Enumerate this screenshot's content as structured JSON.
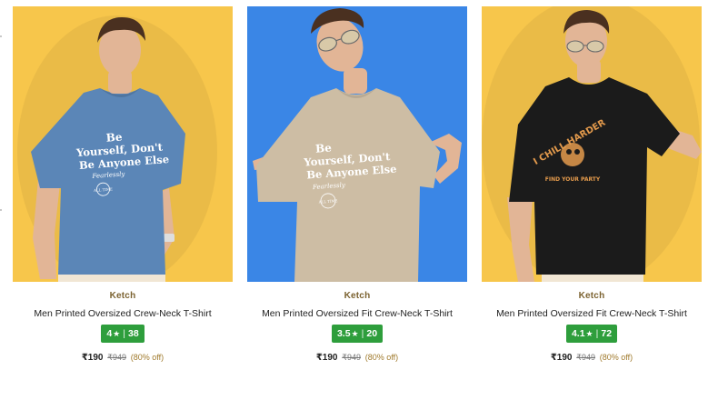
{
  "products": [
    {
      "brand": "Ketch",
      "title": "Men Printed Oversized Crew-Neck T-Shirt",
      "rating": "4",
      "star": "★",
      "reviews": "38",
      "price": "₹190",
      "mrp": "₹949",
      "discount": "(80% off)",
      "background_color": "#f7c64b",
      "shirt_color": "#5b86b7",
      "print_color": "#ffffff",
      "print_lines": [
        "Be",
        "Yourself, Don't",
        "Be Anyone Else"
      ],
      "print_signature": "Fearlessly",
      "print_badge": "ALL TIME"
    },
    {
      "brand": "Ketch",
      "title": "Men Printed Oversized Fit Crew-Neck T-Shirt",
      "rating": "3.5",
      "star": "★",
      "reviews": "20",
      "price": "₹190",
      "mrp": "₹949",
      "discount": "(80% off)",
      "background_color": "#3a86e6",
      "shirt_color": "#cdbda4",
      "print_color": "#ffffff",
      "print_lines": [
        "Be",
        "Yourself, Don't",
        "Be Anyone Else"
      ],
      "print_signature": "Fearlessly",
      "print_badge": "ALL TIME"
    },
    {
      "brand": "Ketch",
      "title": "Men Printed Oversized Fit Crew-Neck T-Shirt",
      "rating": "4.1",
      "star": "★",
      "reviews": "72",
      "price": "₹190",
      "mrp": "₹949",
      "discount": "(80% off)",
      "background_color": "#f7c64b",
      "shirt_color": "#1b1b1b",
      "print_color": "#e39a4c",
      "print_lines": [
        "I CHILL HARDER"
      ],
      "print_signature": "FIND YOUR PARTY",
      "print_badge": ""
    }
  ],
  "colors": {
    "rating_badge": "#2e9e3c",
    "brand_text": "#7b6230",
    "discount_text": "#a07a2c",
    "skin": "#e2b596",
    "hair": "#4a3020",
    "pants": "#f1e6d4"
  }
}
